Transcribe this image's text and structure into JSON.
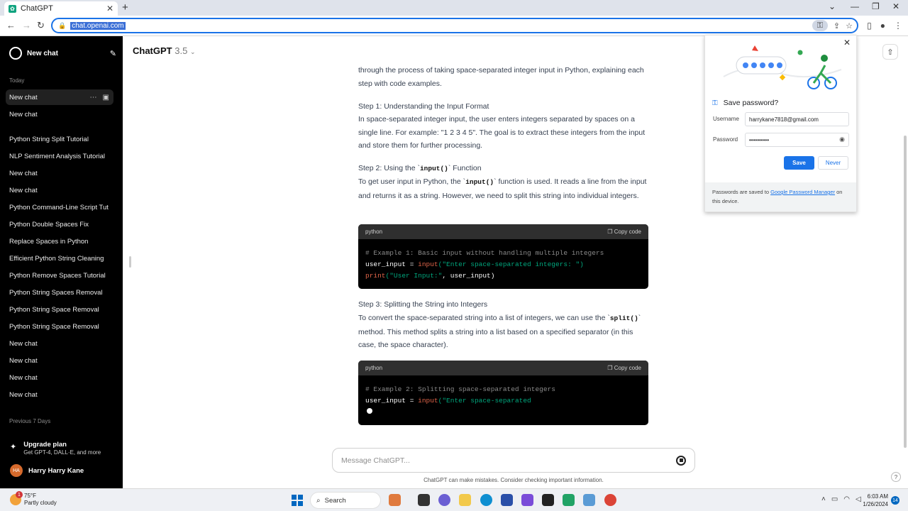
{
  "browser": {
    "tab_title": "ChatGPT",
    "tab_favicon": "chatgpt-favicon",
    "url": "chat.openai.com",
    "new_tab_icon": "+",
    "close_tab_icon": "✕"
  },
  "sidebar": {
    "new_chat_label": "New chat",
    "today_label": "Today",
    "previous_label": "Previous 7 Days",
    "items": [
      {
        "label": "New chat",
        "active": true
      },
      {
        "label": "New chat"
      },
      {
        "label": "Python String Split Tutorial"
      },
      {
        "label": "NLP Sentiment Analysis Tutorial"
      },
      {
        "label": "New chat"
      },
      {
        "label": "New chat"
      },
      {
        "label": "Python Command-Line Script Tut"
      },
      {
        "label": "Python Double Spaces Fix"
      },
      {
        "label": "Replace Spaces in Python"
      },
      {
        "label": "Efficient Python String Cleaning"
      },
      {
        "label": "Python Remove Spaces Tutorial"
      },
      {
        "label": "Python String Spaces Removal"
      },
      {
        "label": "Python String Space Removal"
      },
      {
        "label": "Python String Space Removal"
      },
      {
        "label": "New chat"
      },
      {
        "label": "New chat"
      },
      {
        "label": "New chat"
      },
      {
        "label": "New chat"
      }
    ],
    "upgrade_title": "Upgrade plan",
    "upgrade_subtitle": "Get GPT-4, DALL·E, and more",
    "user_initials": "HA",
    "user_name": "Harry Harry Kane"
  },
  "header": {
    "model_name": "ChatGPT",
    "model_version": "3.5"
  },
  "message": {
    "intro": "through the process of taking space-separated integer input in Python, explaining each step with code examples.",
    "step1_title": "Step 1: Understanding the Input Format",
    "step1_body": "In space-separated integer input, the user enters integers separated by spaces on a single line. For example: \"1 2 3 4 5\". The goal is to extract these integers from the input and store them for further processing.",
    "step2_title_a": "Step 2: Using the `",
    "step2_code": "input()",
    "step2_title_b": "` Function",
    "step2_body_a": "To get user input in Python, the `",
    "step2_body_b": "` function is used. It reads a line from the input and returns it as a string. However, we need to split this string into individual integers.",
    "step3_title": "Step 3: Splitting the String into Integers",
    "step3_body_a": "To convert the space-separated string into a list of integers, we can use the `",
    "step3_code": "split()",
    "step3_body_b": "` method. This method splits a string into a list based on a specified separator (in this case, the space character).",
    "code_lang": "python",
    "copy_label": "Copy code",
    "code1": {
      "comment": "# Example 1: Basic input without handling multiple integers",
      "line2_var": "user_input = ",
      "line2_fn": "input",
      "line2_str": "(\"Enter space-separated integers: \")",
      "line3_fn": "print",
      "line3_str": "(\"User Input:\"",
      "line3_rest": ", user_input)"
    },
    "code2": {
      "comment": "# Example 2: Splitting space-separated integers",
      "line2_var": "user_input = ",
      "line2_fn": "input",
      "line2_str": "(\"Enter space-separated"
    }
  },
  "composer": {
    "placeholder": "Message ChatGPT...",
    "disclaimer": "ChatGPT can make mistakes. Consider checking important information.",
    "help": "?"
  },
  "password_popup": {
    "title": "Save password?",
    "username_label": "Username",
    "username_value": "harrykane7818@gmail.com",
    "password_label": "Password",
    "password_value": "••••••••••",
    "save_label": "Save",
    "never_label": "Never",
    "footer_a": "Passwords are saved to ",
    "footer_link": "Google Password Manager",
    "footer_b": " on this device."
  },
  "taskbar": {
    "weather_temp": "75°F",
    "weather_desc": "Partly cloudy",
    "weather_badge": "1",
    "search_label": "Search",
    "time": "6:03 AM",
    "date": "1/26/2024",
    "notif_count": "14"
  },
  "colors": {
    "accent": "#1a73e8",
    "sidebar_bg": "#000000",
    "code_fn": "#e2664a",
    "code_str": "#00a67d"
  }
}
